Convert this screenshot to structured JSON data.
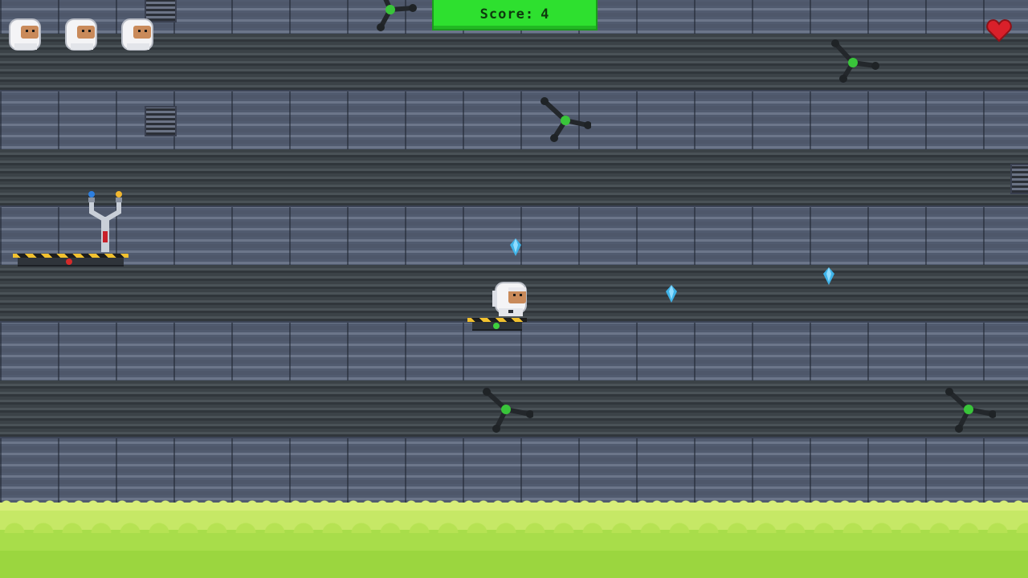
{
  "hud": {
    "score_label": "Score:",
    "score_value": "4",
    "lives_remaining": 3,
    "health_icon": "heart-icon"
  },
  "colors": {
    "score_bg": "#2ee02f",
    "acid": "#c6e866",
    "wall_light": "#5b6478",
    "wall_dark": "#3c4349",
    "crystal": "#3fb3e8",
    "heart": "#d9202a"
  },
  "entities": {
    "player": "astronaut",
    "collectibles": [
      "blue-crystal",
      "blue-crystal",
      "blue-crystal"
    ],
    "enemies": [
      "drone",
      "drone",
      "drone",
      "drone",
      "drone"
    ],
    "platforms": [
      "hazard-platform-red-light",
      "hazard-platform-green-light"
    ],
    "hazard": "acid-pool"
  }
}
